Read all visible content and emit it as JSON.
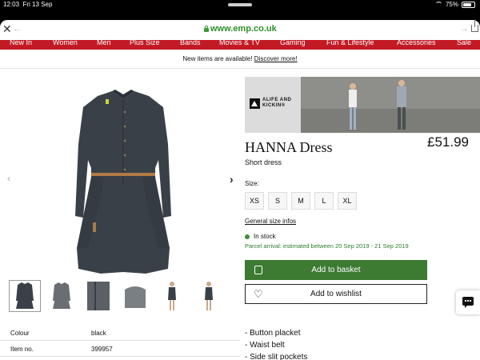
{
  "status_bar": {
    "time": "12:03",
    "date": "Fri 13 Sep",
    "battery": "75%",
    "battery_level": 0.75
  },
  "browser": {
    "url": "www.emp.co.uk"
  },
  "nav": {
    "items": [
      "New In",
      "Women",
      "Men",
      "Plus Size",
      "Bands",
      "Movies & TV",
      "Gaming",
      "Fun & Lifestyle",
      "Accessories",
      "Sale"
    ]
  },
  "notice": {
    "text": "New items are available! ",
    "link": "Discover more!"
  },
  "product": {
    "brand_line1": "ALIFE AND",
    "brand_line2": "KICKIN®",
    "name": "HANNA Dress",
    "subtitle": "Short dress",
    "price": "£51.99",
    "size_label": "Size:",
    "sizes": [
      "XS",
      "S",
      "M",
      "L",
      "XL"
    ],
    "size_guide": "General size infos",
    "stock": "In stock",
    "arrival": "Parcel arrival: estimated between 20 Sep 2019 - 21 Sep 2019",
    "add_to_basket": "Add to basket",
    "add_to_wishlist": "Add to wishlist",
    "features": [
      "- Button placket",
      "- Waist belt",
      "- Side slit pockets"
    ]
  },
  "spec": [
    {
      "key": "Colour",
      "value": "black"
    },
    {
      "key": "Item no.",
      "value": "399957"
    }
  ],
  "colors": {
    "nav_red": "#c21a25",
    "basket_green": "#3d7a32",
    "url_green": "#2f8e2a",
    "dress": "#3a4048"
  }
}
